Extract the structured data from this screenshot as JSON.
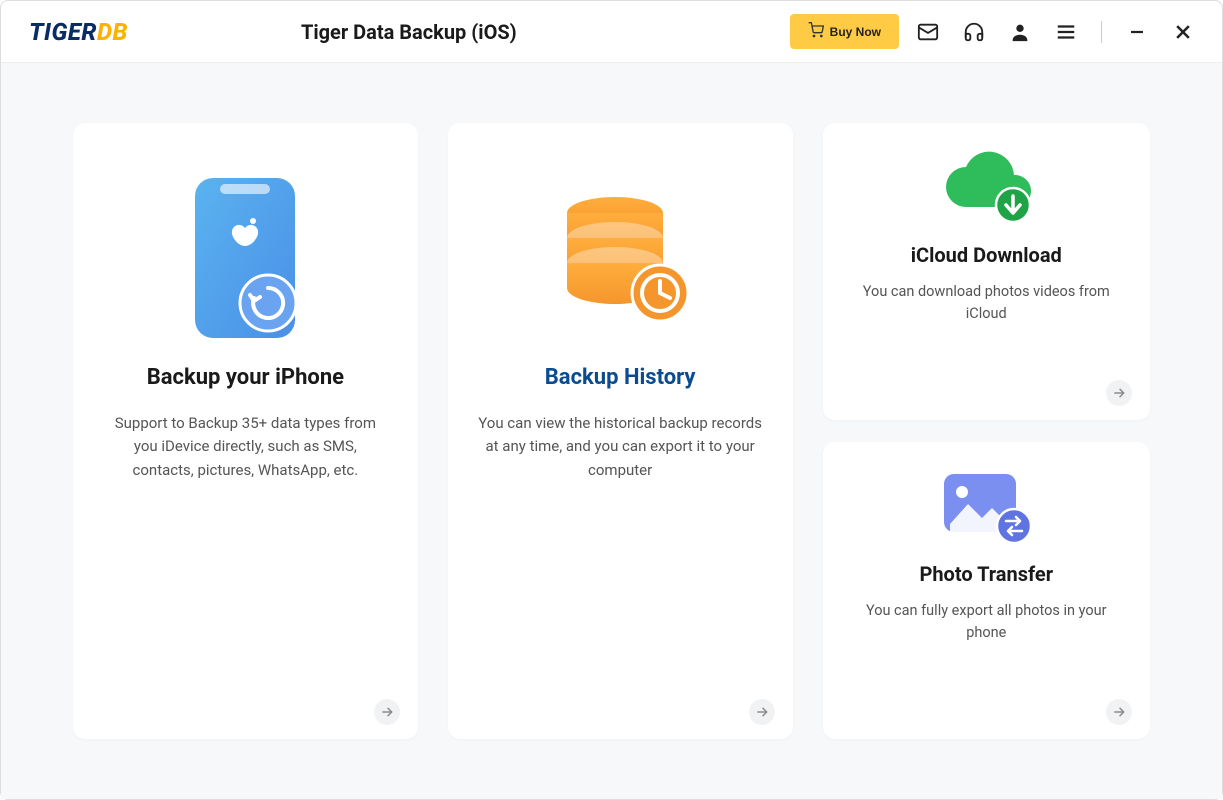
{
  "header": {
    "logo_part1": "TIGER",
    "logo_part2": "DB",
    "title": "Tiger Data Backup (iOS)",
    "buy_label": "Buy Now"
  },
  "cards": {
    "backup": {
      "title": "Backup your iPhone",
      "desc": "Support to Backup 35+ data types from you iDevice directly, such as SMS, contacts, pictures, WhatsApp, etc."
    },
    "history": {
      "title": "Backup History",
      "desc": "You can view the historical backup records at any time, and you can export it to your computer"
    },
    "icloud": {
      "title": "iCloud Download",
      "desc": "You can download photos videos from iCloud"
    },
    "photo": {
      "title": "Photo Transfer",
      "desc": "You can fully export all photos in your phone"
    }
  }
}
